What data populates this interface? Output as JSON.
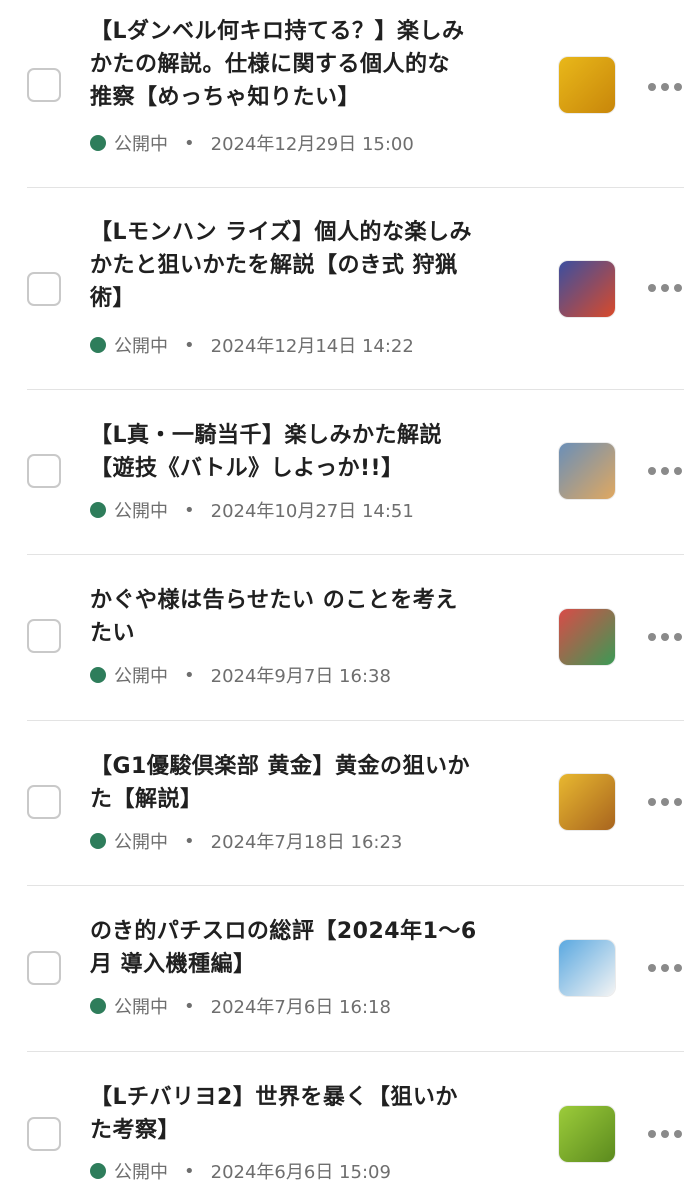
{
  "status_color": "#2e7d5b",
  "articles": [
    {
      "title_lines": [
        "【Lダンベル何キロ持てる？】楽しみ",
        "かたの解説。仕様に関する個人的な",
        "推察【めっちゃ知りたい】"
      ],
      "status": "公開中",
      "date": "2024年12月29日 15:00",
      "thumb_colors": [
        "#e9b81a",
        "#c8860a"
      ]
    },
    {
      "title_lines": [
        "【Lモンハン ライズ】個人的な楽しみ",
        "かたと狙いかたを解説【のき式 狩猟",
        "術】"
      ],
      "status": "公開中",
      "date": "2024年12月14日 14:22",
      "thumb_colors": [
        "#3b4fa0",
        "#d94a2a"
      ]
    },
    {
      "title_lines": [
        "【L真・一騎当千】楽しみかた解説",
        "【遊技《バトル》しよっか!!】"
      ],
      "status": "公開中",
      "date": "2024年10月27日 14:51",
      "thumb_colors": [
        "#6a8fb8",
        "#e0a860"
      ]
    },
    {
      "title_lines": [
        "かぐや様は告らせたい のことを考え",
        "たい"
      ],
      "status": "公開中",
      "date": "2024年9月7日 16:38",
      "thumb_colors": [
        "#d94b48",
        "#3b9a55"
      ]
    },
    {
      "title_lines": [
        "【G1優駿倶楽部 黄金】黄金の狙いか",
        "た【解説】"
      ],
      "status": "公開中",
      "date": "2024年7月18日 16:23",
      "thumb_colors": [
        "#e8b830",
        "#a8641e"
      ]
    },
    {
      "title_lines": [
        "のき的パチスロの総評【2024年1〜6",
        "月 導入機種編】"
      ],
      "status": "公開中",
      "date": "2024年7月6日 16:18",
      "thumb_colors": [
        "#5aa8e0",
        "#f4f4f4"
      ]
    },
    {
      "title_lines": [
        "【Lチバリヨ2】世界を暴く【狙いか",
        "た考察】"
      ],
      "status": "公開中",
      "date": "2024年6月6日 15:09",
      "thumb_colors": [
        "#9ccc3a",
        "#5b8a1e"
      ]
    }
  ]
}
